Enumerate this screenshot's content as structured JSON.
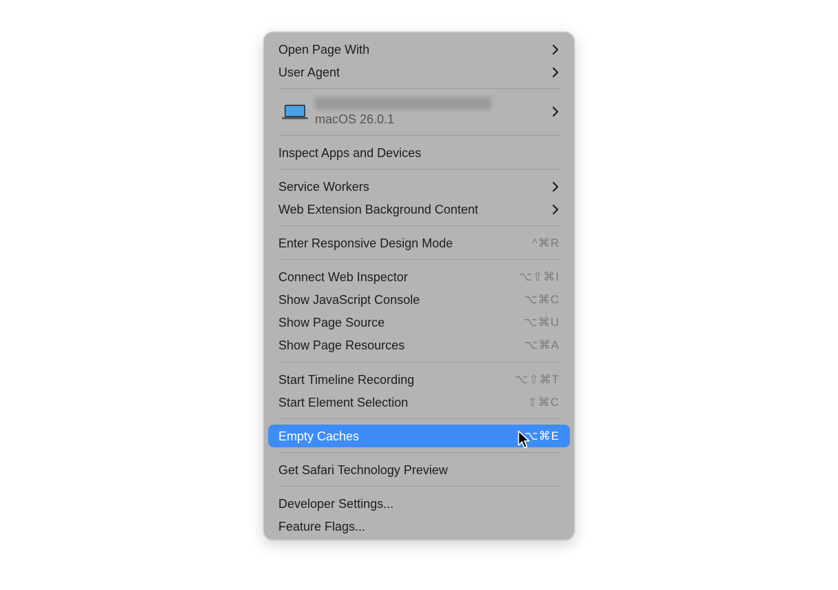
{
  "menu": {
    "items": [
      {
        "id": "open-page-with",
        "label": "Open Page With",
        "submenu": true
      },
      {
        "id": "user-agent",
        "label": "User Agent",
        "submenu": true
      },
      {
        "id": "inspect-apps",
        "label": "Inspect Apps and Devices"
      },
      {
        "id": "service-workers",
        "label": "Service Workers",
        "submenu": true
      },
      {
        "id": "web-extension-bg",
        "label": "Web Extension Background Content",
        "submenu": true
      },
      {
        "id": "responsive-design",
        "label": "Enter Responsive Design Mode",
        "shortcut": "^⌘R"
      },
      {
        "id": "connect-inspector",
        "label": "Connect Web Inspector",
        "shortcut": "⌥⇧⌘I"
      },
      {
        "id": "js-console",
        "label": "Show JavaScript Console",
        "shortcut": "⌥⌘C"
      },
      {
        "id": "page-source",
        "label": "Show Page Source",
        "shortcut": "⌥⌘U"
      },
      {
        "id": "page-resources",
        "label": "Show Page Resources",
        "shortcut": "⌥⌘A"
      },
      {
        "id": "timeline-recording",
        "label": "Start Timeline Recording",
        "shortcut": "⌥⇧⌘T"
      },
      {
        "id": "element-selection",
        "label": "Start Element Selection",
        "shortcut": "⇧⌘C"
      },
      {
        "id": "empty-caches",
        "label": "Empty Caches",
        "shortcut": "⌥⌘E",
        "highlighted": true
      },
      {
        "id": "safari-tech-preview",
        "label": "Get Safari Technology Preview"
      },
      {
        "id": "developer-settings",
        "label": "Developer Settings..."
      },
      {
        "id": "feature-flags",
        "label": "Feature Flags..."
      }
    ],
    "device": {
      "os_version": "macOS 26.0.1",
      "icon": "laptop-icon"
    }
  },
  "colors": {
    "menu_bg": "#b4b4b4",
    "highlight": "#3e8cf7",
    "text": "#1d1d1d",
    "shortcut": "#7a7a7a"
  }
}
